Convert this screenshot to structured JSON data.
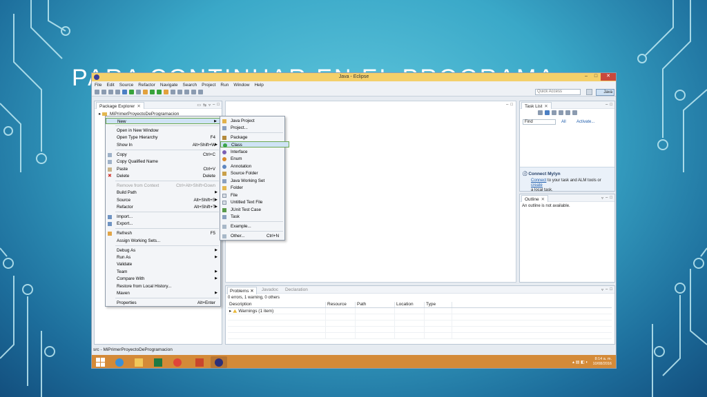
{
  "slide": {
    "title": "PARA CONTINUAR EN EL PROGRAMA"
  },
  "window": {
    "title": "Java - Eclipse",
    "controls": {
      "minimize": "–",
      "maximize": "□",
      "close": "✕"
    }
  },
  "menubar": [
    "File",
    "Edit",
    "Source",
    "Refactor",
    "Navigate",
    "Search",
    "Project",
    "Run",
    "Window",
    "Help"
  ],
  "toolbar": {
    "quick_access_placeholder": "Quick Access",
    "perspective": "Java"
  },
  "package_explorer": {
    "tab_label": "Package Explorer",
    "project": "MiPrimerProyectoDeProgramacion"
  },
  "task_list": {
    "tab_label": "Task List",
    "find_placeholder": "Find",
    "all_label": "All",
    "activate_label": "Activate..."
  },
  "mylyn": {
    "title": "Connect Mylyn",
    "connect_link": "Connect",
    "text_middle": " to your task and ALM tools or ",
    "create_link": "create",
    "text_end": "a local task."
  },
  "outline": {
    "tab_label": "Outline",
    "message": "An outline is not available."
  },
  "problems": {
    "tabs": [
      "Problems",
      "Javadoc",
      "Declaration"
    ],
    "summary": "0 errors, 1 warning, 0 others",
    "columns": [
      "Description",
      "Resource",
      "Path",
      "Location",
      "Type"
    ],
    "rows": [
      {
        "description": "Warnings (1 item)"
      }
    ]
  },
  "statusbar": {
    "text": "src - MiPrimerProyectoDeProgramacion"
  },
  "taskbar": {
    "time": "8:14 a. m.",
    "date": "10/08/2016"
  },
  "context_menu": {
    "items": [
      {
        "label": "New",
        "submenu": true
      },
      {
        "label": "Open in New Window"
      },
      {
        "label": "Open Type Hierarchy",
        "shortcut": "F4"
      },
      {
        "label": "Show In",
        "shortcut": "Alt+Shift+W",
        "submenu": true
      },
      {
        "label": "Copy",
        "shortcut": "Ctrl+C"
      },
      {
        "label": "Copy Qualified Name"
      },
      {
        "label": "Paste",
        "shortcut": "Ctrl+V"
      },
      {
        "label": "Delete",
        "shortcut": "Delete"
      },
      {
        "label": "Remove from Context",
        "shortcut": "Ctrl+Alt+Shift+Down"
      },
      {
        "label": "Build Path",
        "submenu": true
      },
      {
        "label": "Source",
        "shortcut": "Alt+Shift+S",
        "submenu": true
      },
      {
        "label": "Refactor",
        "shortcut": "Alt+Shift+T",
        "submenu": true
      },
      {
        "label": "Import..."
      },
      {
        "label": "Export..."
      },
      {
        "label": "Refresh",
        "shortcut": "F5"
      },
      {
        "label": "Assign Working Sets..."
      },
      {
        "label": "Debug As",
        "submenu": true
      },
      {
        "label": "Run As",
        "submenu": true
      },
      {
        "label": "Validate"
      },
      {
        "label": "Team",
        "submenu": true
      },
      {
        "label": "Compare With",
        "submenu": true
      },
      {
        "label": "Restore from Local History..."
      },
      {
        "label": "Maven",
        "submenu": true
      },
      {
        "label": "Properties",
        "shortcut": "Alt+Enter"
      }
    ]
  },
  "submenu_new": {
    "items": [
      {
        "label": "Java Project"
      },
      {
        "label": "Project..."
      },
      {
        "label": "Package"
      },
      {
        "label": "Class"
      },
      {
        "label": "Interface"
      },
      {
        "label": "Enum"
      },
      {
        "label": "Annotation"
      },
      {
        "label": "Source Folder"
      },
      {
        "label": "Java Working Set"
      },
      {
        "label": "Folder"
      },
      {
        "label": "File"
      },
      {
        "label": "Untitled Text File"
      },
      {
        "label": "JUnit Test Case"
      },
      {
        "label": "Task"
      },
      {
        "label": "Example..."
      },
      {
        "label": "Other...",
        "shortcut": "Ctrl+N"
      }
    ]
  },
  "colors": {
    "window_title_bar": "#f4d06a",
    "taskbar": "#d48a38",
    "highlight_border": "#6aa84f",
    "link": "#1c5bab"
  }
}
